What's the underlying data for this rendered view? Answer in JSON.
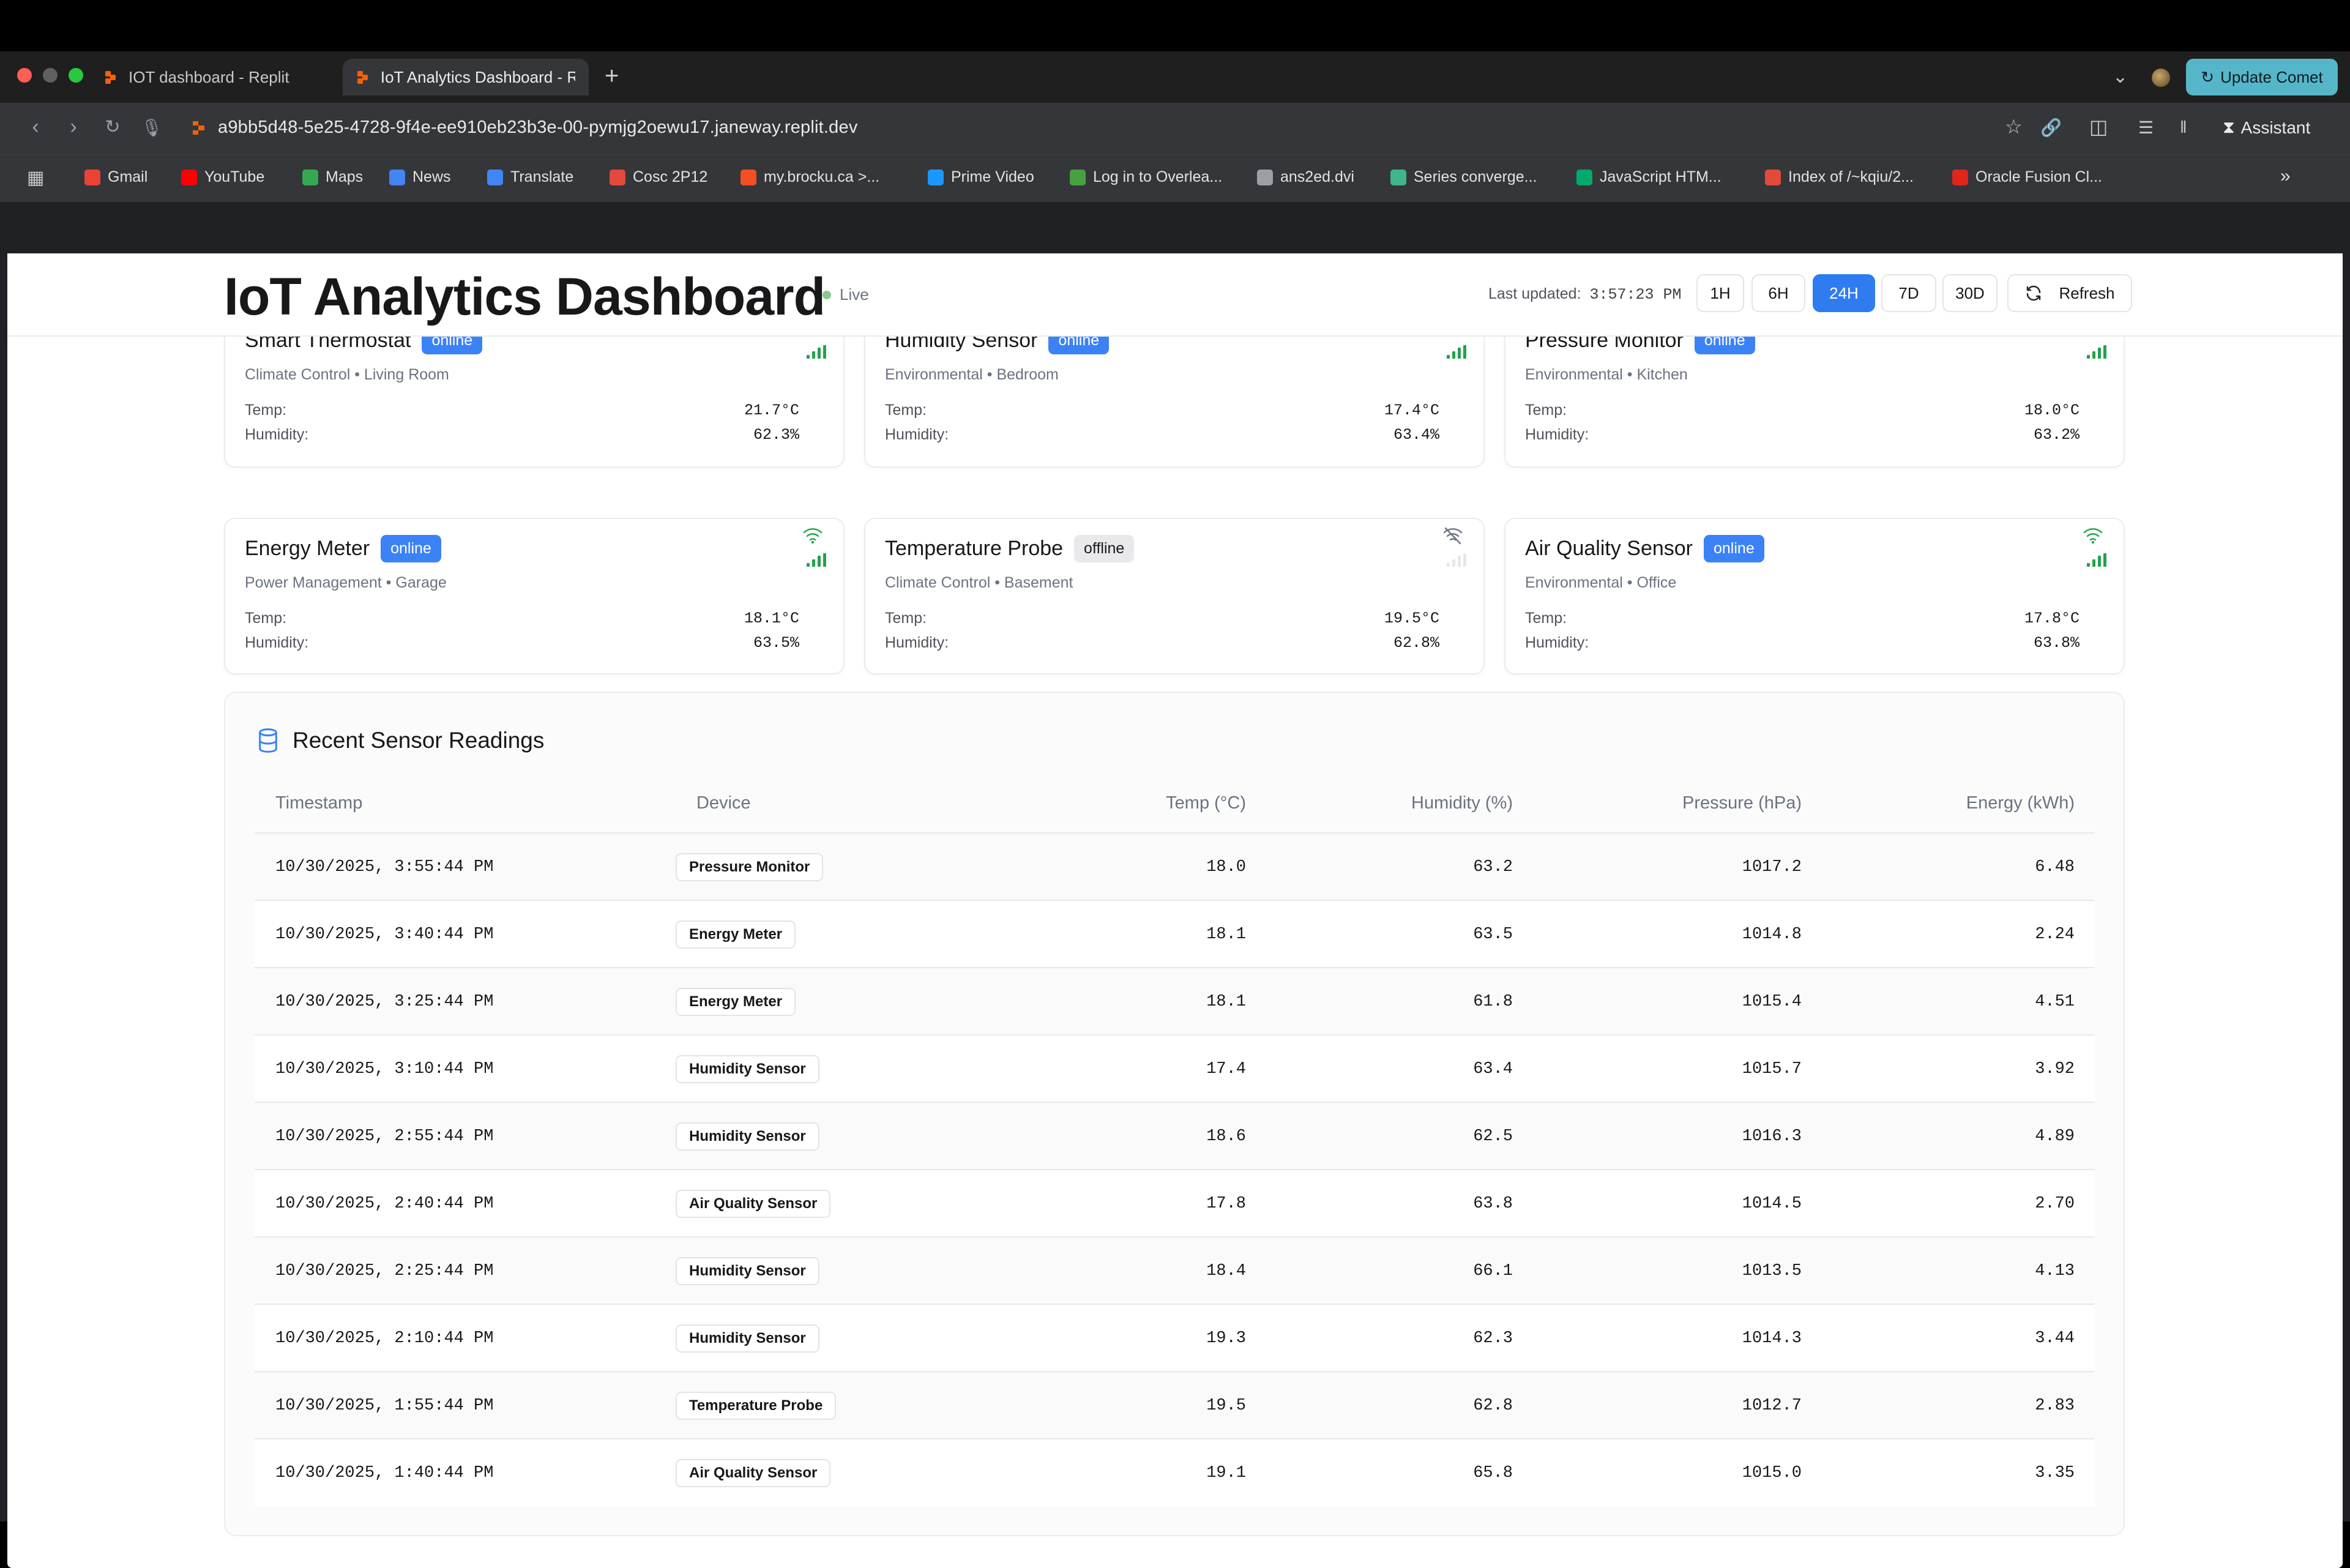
{
  "browser": {
    "tabs": [
      {
        "label": "IOT dashboard - Replit"
      },
      {
        "label": "IoT Analytics Dashboard - R"
      }
    ],
    "update_label": "Update Comet",
    "url": "a9bb5d48-5e25-4728-9f4e-ee910eb23b3e-00-pymjg2oewu17.janeway.replit.dev",
    "assistant_label": "Assistant",
    "bookmarks": [
      {
        "label": "Gmail",
        "icon": "gmail-icon",
        "color": "#ea4335"
      },
      {
        "label": "YouTube",
        "icon": "youtube-icon",
        "color": "#ff0000"
      },
      {
        "label": "Maps",
        "icon": "maps-icon",
        "color": "#34a853"
      },
      {
        "label": "News",
        "icon": "news-icon",
        "color": "#4285f4"
      },
      {
        "label": "Translate",
        "icon": "translate-icon",
        "color": "#4285f4"
      },
      {
        "label": "Cosc 2P12",
        "icon": "cosc-icon",
        "color": "#e24a3b"
      },
      {
        "label": "my.brocku.ca >...",
        "icon": "windows-icon",
        "color": "#f25022"
      },
      {
        "label": "Prime Video",
        "icon": "prime-video-icon",
        "color": "#1a98ff"
      },
      {
        "label": "Log in to Overlea...",
        "icon": "overleaf-icon",
        "color": "#47a141"
      },
      {
        "label": "ans2ed.dvi",
        "icon": "globe-icon",
        "color": "#9aa0a6"
      },
      {
        "label": "Series converge...",
        "icon": "series-icon",
        "color": "#3fb68b"
      },
      {
        "label": "JavaScript HTM...",
        "icon": "w3schools-icon",
        "color": "#04aa6d"
      },
      {
        "label": "Index of /~kqiu/2...",
        "icon": "index-icon",
        "color": "#e24a3b"
      },
      {
        "label": "Oracle Fusion Cl...",
        "icon": "oracle-icon",
        "color": "#e1251b"
      }
    ]
  },
  "header": {
    "title": "IoT Analytics Dashboard",
    "live_label": "Live",
    "last_updated_label": "Last updated:",
    "last_updated_time": "3:57:23 PM",
    "ranges": [
      "1H",
      "6H",
      "24H",
      "7D",
      "30D"
    ],
    "active_range": "24H",
    "refresh_label": "Refresh"
  },
  "devices": [
    {
      "name": "Smart Thermostat",
      "status": "online",
      "meta": "Climate Control • Living Room",
      "temp_label": "Temp:",
      "temp": "21.7°C",
      "humidity_label": "Humidity:",
      "humidity": "62.3%"
    },
    {
      "name": "Humidity Sensor",
      "status": "online",
      "meta": "Environmental • Bedroom",
      "temp_label": "Temp:",
      "temp": "17.4°C",
      "humidity_label": "Humidity:",
      "humidity": "63.4%"
    },
    {
      "name": "Pressure Monitor",
      "status": "online",
      "meta": "Environmental • Kitchen",
      "temp_label": "Temp:",
      "temp": "18.0°C",
      "humidity_label": "Humidity:",
      "humidity": "63.2%"
    },
    {
      "name": "Energy Meter",
      "status": "online",
      "meta": "Power Management • Garage",
      "temp_label": "Temp:",
      "temp": "18.1°C",
      "humidity_label": "Humidity:",
      "humidity": "63.5%"
    },
    {
      "name": "Temperature Probe",
      "status": "offline",
      "meta": "Climate Control • Basement",
      "temp_label": "Temp:",
      "temp": "19.5°C",
      "humidity_label": "Humidity:",
      "humidity": "62.8%"
    },
    {
      "name": "Air Quality Sensor",
      "status": "online",
      "meta": "Environmental • Office",
      "temp_label": "Temp:",
      "temp": "17.8°C",
      "humidity_label": "Humidity:",
      "humidity": "63.8%"
    }
  ],
  "readings": {
    "title": "Recent Sensor Readings",
    "columns": [
      "Timestamp",
      "Device",
      "Temp (°C)",
      "Humidity (%)",
      "Pressure (hPa)",
      "Energy (kWh)"
    ],
    "rows": [
      {
        "timestamp": "10/30/2025, 3:55:44 PM",
        "device": "Pressure Monitor",
        "temp": "18.0",
        "humidity": "63.2",
        "pressure": "1017.2",
        "energy": "6.48"
      },
      {
        "timestamp": "10/30/2025, 3:40:44 PM",
        "device": "Energy Meter",
        "temp": "18.1",
        "humidity": "63.5",
        "pressure": "1014.8",
        "energy": "2.24"
      },
      {
        "timestamp": "10/30/2025, 3:25:44 PM",
        "device": "Energy Meter",
        "temp": "18.1",
        "humidity": "61.8",
        "pressure": "1015.4",
        "energy": "4.51"
      },
      {
        "timestamp": "10/30/2025, 3:10:44 PM",
        "device": "Humidity Sensor",
        "temp": "17.4",
        "humidity": "63.4",
        "pressure": "1015.7",
        "energy": "3.92"
      },
      {
        "timestamp": "10/30/2025, 2:55:44 PM",
        "device": "Humidity Sensor",
        "temp": "18.6",
        "humidity": "62.5",
        "pressure": "1016.3",
        "energy": "4.89"
      },
      {
        "timestamp": "10/30/2025, 2:40:44 PM",
        "device": "Air Quality Sensor",
        "temp": "17.8",
        "humidity": "63.8",
        "pressure": "1014.5",
        "energy": "2.70"
      },
      {
        "timestamp": "10/30/2025, 2:25:44 PM",
        "device": "Humidity Sensor",
        "temp": "18.4",
        "humidity": "66.1",
        "pressure": "1013.5",
        "energy": "4.13"
      },
      {
        "timestamp": "10/30/2025, 2:10:44 PM",
        "device": "Humidity Sensor",
        "temp": "19.3",
        "humidity": "62.3",
        "pressure": "1014.3",
        "energy": "3.44"
      },
      {
        "timestamp": "10/30/2025, 1:55:44 PM",
        "device": "Temperature Probe",
        "temp": "19.5",
        "humidity": "62.8",
        "pressure": "1012.7",
        "energy": "2.83"
      },
      {
        "timestamp": "10/30/2025, 1:40:44 PM",
        "device": "Air Quality Sensor",
        "temp": "19.1",
        "humidity": "65.8",
        "pressure": "1015.0",
        "energy": "3.35"
      }
    ]
  },
  "colors": {
    "accent": "#2f7cf0",
    "online": "#3b82f6",
    "signal": "#22a34a",
    "live_dot": "#86c88e",
    "update_button": "#56b6c9"
  }
}
